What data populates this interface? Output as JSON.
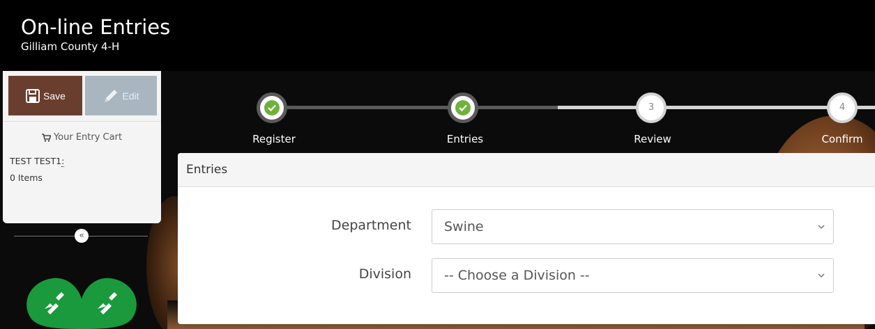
{
  "header": {
    "title": "On-line Entries",
    "subtitle": "Gilliam County 4-H"
  },
  "sidebar": {
    "save_label": "Save",
    "edit_label": "Edit",
    "cart_title": "Your Entry Cart",
    "participant_name": "TEST TEST1",
    "participant_suffix": ":",
    "item_count": "0 Items",
    "collapse_glyph": "«"
  },
  "stepper": {
    "steps": [
      {
        "label": "Register",
        "state": "done"
      },
      {
        "label": "Entries",
        "state": "done"
      },
      {
        "label": "Review",
        "number": "3",
        "state": "todo"
      },
      {
        "label": "Confirm",
        "number": "4",
        "state": "todo"
      }
    ]
  },
  "panel": {
    "title": "Entries",
    "department_label": "Department",
    "department_value": "Swine",
    "division_label": "Division",
    "division_value": "-- Choose a Division --"
  },
  "colors": {
    "save_button": "#6a3e2e",
    "edit_button": "#a9b6bf",
    "step_done_check": "#6fb13a",
    "logo_green": "#1a9a3c"
  },
  "icons": {
    "save": "floppy-disk-icon",
    "edit": "pencil-icon",
    "cart": "shopping-cart-icon",
    "check": "checkmark-icon",
    "collapse": "double-chevron-left-icon",
    "select": "chevron-down-icon",
    "logo": "4h-clover-logo"
  }
}
